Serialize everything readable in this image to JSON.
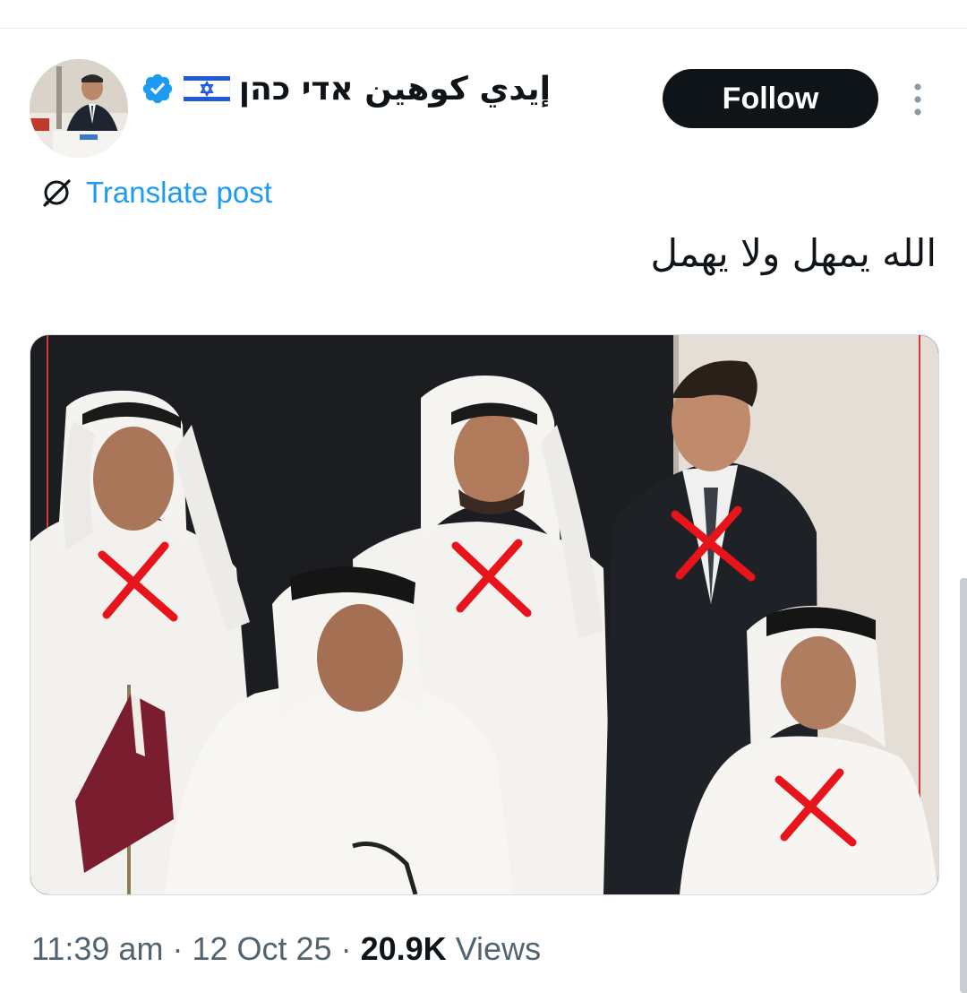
{
  "author": {
    "display_name": "إيدي كوهين אדי כהן",
    "verified": true,
    "flag": "israel-flag"
  },
  "header": {
    "follow_label": "Follow",
    "more_icon": "more-vertical-icon"
  },
  "translate": {
    "label": "Translate post",
    "icon": "translate-icon"
  },
  "post": {
    "text": "الله يمهل ولا يهمل",
    "media": {
      "description_marks": 4,
      "mark_color": "#e8141b"
    }
  },
  "meta": {
    "time": "11:39 am",
    "separator": "·",
    "date": "12 Oct 25",
    "views_count": "20.9K",
    "views_label": "Views"
  },
  "colors": {
    "link": "#1d9bf0",
    "text": "#0f1419",
    "muted": "#536471",
    "verified": "#1d9bf0"
  }
}
